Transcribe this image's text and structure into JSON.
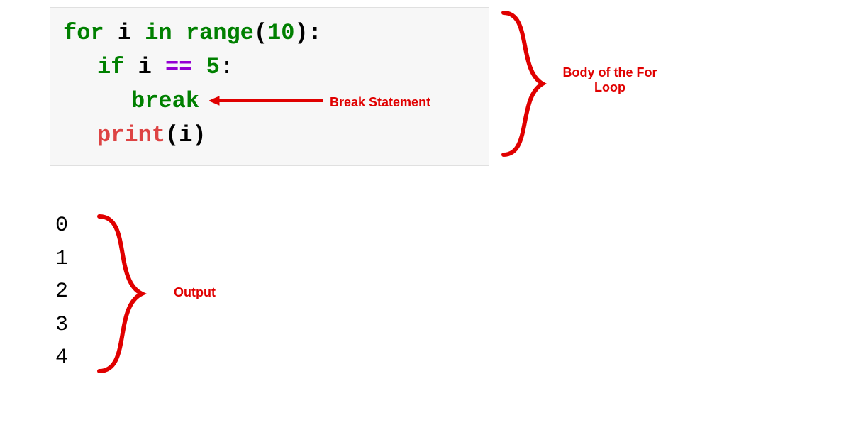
{
  "code": {
    "line1": {
      "for": "for",
      "i1": " i ",
      "in": "in",
      "sp1": " ",
      "range": "range",
      "open": "(",
      "arg": "10",
      "close": ")",
      "colon": ":"
    },
    "line2": {
      "if": "if",
      "i2": " i ",
      "eq": "==",
      "sp2": " ",
      "five": "5",
      "colon2": ":"
    },
    "line3": {
      "break": "break"
    },
    "line4": {
      "print": "print",
      "open2": "(",
      "i3": "i",
      "close2": ")"
    }
  },
  "output": {
    "v0": "0",
    "v1": "1",
    "v2": "2",
    "v3": "3",
    "v4": "4"
  },
  "annotations": {
    "break_label": "Break Statement",
    "body_label_l1": "Body of the For",
    "body_label_l2": "Loop",
    "output_label": "Output"
  },
  "colors": {
    "accent": "#e00000"
  }
}
